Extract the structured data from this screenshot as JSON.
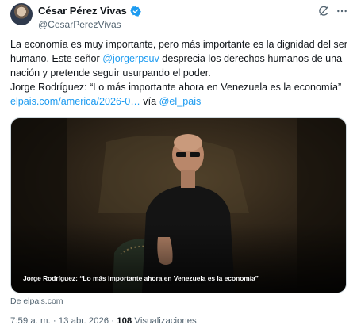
{
  "author": {
    "name": "César Pérez Vivas",
    "handle": "@CesarPerezVivas"
  },
  "icons": [
    "verified-badge-icon",
    "grok-icon",
    "more-icon"
  ],
  "colors": {
    "link": "#1d9bf0",
    "secondary_text": "#536471",
    "verified": "#1d9bf0"
  },
  "tweet": {
    "line1": "La economía es muy importante, pero más importante es la dignidad del ser humano. Este señor ",
    "mention1": "@jorgerpsuv",
    "line1b": " desprecia los derechos humanos de una nación y pretende seguir usurpando el poder.",
    "line2": "Jorge Rodríguez: “Lo más importante ahora en Venezuela es la economía” ",
    "url": "elpais.com/america/2026-0…",
    "via": " vía ",
    "mention2": "@el_pais"
  },
  "card": {
    "caption": "Jorge Rodríguez: “Lo más importante ahora en Venezuela es la economía”",
    "source": "De elpais.com"
  },
  "meta": {
    "time": "7:59 a. m.",
    "sep1": " · ",
    "date": "13 abr. 2026",
    "sep2": " · ",
    "views_count": "108",
    "views_label": " Visualizaciones"
  }
}
